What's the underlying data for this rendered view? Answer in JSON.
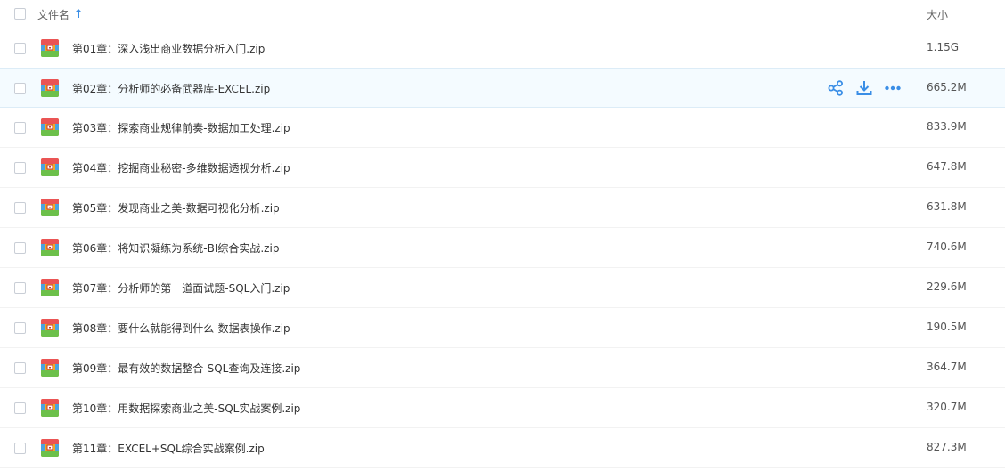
{
  "header": {
    "name_label": "文件名",
    "size_label": "大小"
  },
  "colors": {
    "accent": "#3a8ee6",
    "row_hover_bg": "#f4fbff"
  },
  "files": [
    {
      "name": "第01章：深入浅出商业数据分析入门.zip",
      "size": "1.15G",
      "hovered": false
    },
    {
      "name": "第02章：分析师的必备武器库-EXCEL.zip",
      "size": "665.2M",
      "hovered": true
    },
    {
      "name": "第03章：探索商业规律前奏-数据加工处理.zip",
      "size": "833.9M",
      "hovered": false
    },
    {
      "name": "第04章：挖掘商业秘密-多维数据透视分析.zip",
      "size": "647.8M",
      "hovered": false
    },
    {
      "name": "第05章：发现商业之美-数据可视化分析.zip",
      "size": "631.8M",
      "hovered": false
    },
    {
      "name": "第06章：将知识凝练为系统-BI综合实战.zip",
      "size": "740.6M",
      "hovered": false
    },
    {
      "name": "第07章：分析师的第一道面试题-SQL入门.zip",
      "size": "229.6M",
      "hovered": false
    },
    {
      "name": "第08章：要什么就能得到什么-数据表操作.zip",
      "size": "190.5M",
      "hovered": false
    },
    {
      "name": "第09章：最有效的数据整合-SQL查询及连接.zip",
      "size": "364.7M",
      "hovered": false
    },
    {
      "name": "第10章：用数据探索商业之美-SQL实战案例.zip",
      "size": "320.7M",
      "hovered": false
    },
    {
      "name": "第11章：EXCEL+SQL综合实战案例.zip",
      "size": "827.3M",
      "hovered": false
    }
  ],
  "icons": {
    "file": "zip-archive-icon",
    "share": "share-icon",
    "download": "download-icon",
    "more": "more-icon",
    "sort": "sort-ascending-arrow-icon"
  }
}
